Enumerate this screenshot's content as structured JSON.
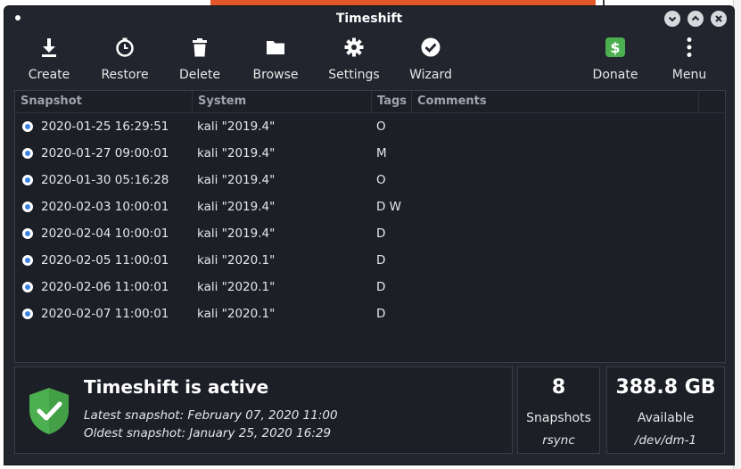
{
  "window": {
    "title": "Timeshift"
  },
  "toolbar": {
    "create": "Create",
    "restore": "Restore",
    "delete": "Delete",
    "browse": "Browse",
    "settings": "Settings",
    "wizard": "Wizard",
    "donate": "Donate",
    "menu": "Menu"
  },
  "table": {
    "columns": [
      "Snapshot",
      "System",
      "Tags",
      "Comments"
    ],
    "rows": [
      {
        "snapshot": "2020-01-25 16:29:51",
        "system": "kali \"2019.4\"",
        "tags": "O",
        "comments": ""
      },
      {
        "snapshot": "2020-01-27 09:00:01",
        "system": "kali \"2019.4\"",
        "tags": "M",
        "comments": ""
      },
      {
        "snapshot": "2020-01-30 05:16:28",
        "system": "kali \"2019.4\"",
        "tags": "O",
        "comments": ""
      },
      {
        "snapshot": "2020-02-03 10:00:01",
        "system": "kali \"2019.4\"",
        "tags": "D W",
        "comments": ""
      },
      {
        "snapshot": "2020-02-04 10:00:01",
        "system": "kali \"2019.4\"",
        "tags": "D",
        "comments": ""
      },
      {
        "snapshot": "2020-02-05 11:00:01",
        "system": "kali \"2020.1\"",
        "tags": "D",
        "comments": ""
      },
      {
        "snapshot": "2020-02-06 11:00:01",
        "system": "kali \"2020.1\"",
        "tags": "D",
        "comments": ""
      },
      {
        "snapshot": "2020-02-07 11:00:01",
        "system": "kali \"2020.1\"",
        "tags": "D",
        "comments": ""
      }
    ]
  },
  "status": {
    "title": "Timeshift is active",
    "latest": "Latest snapshot: February 07, 2020 11:00",
    "oldest": "Oldest snapshot: January 25, 2020 16:29"
  },
  "stats": {
    "count_value": "8",
    "count_label": "Snapshots",
    "count_mode": "rsync",
    "space_value": "388.8 GB",
    "space_label": "Available",
    "space_device": "/dev/dm-1"
  },
  "colors": {
    "window_bg": "#23252e",
    "panel_bg": "#1d1f27",
    "shield_green": "#4caf50",
    "donate_green": "#4caf50",
    "check_blue": "#3b83e0"
  }
}
